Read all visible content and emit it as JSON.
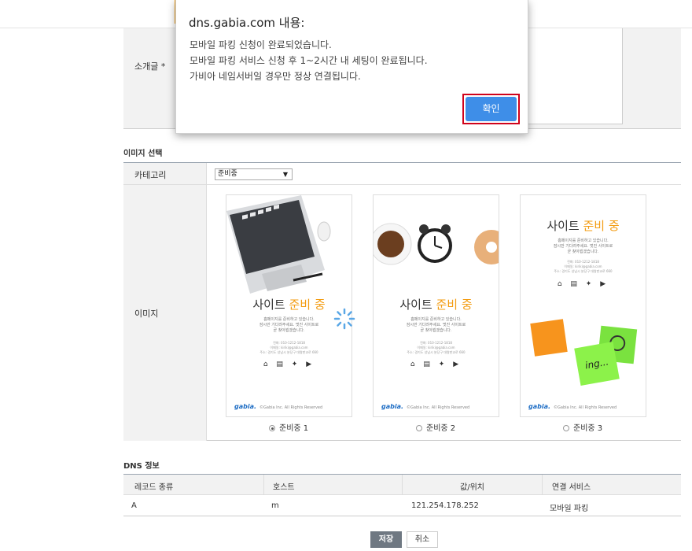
{
  "dialog": {
    "title": "dns.gabia.com 내용:",
    "lines": [
      "모바일 파킹 신청이 완료되었습니다.",
      "모바일 파킹 서비스 신청 후 1~2시간 내 세팅이 완료됩니다.",
      "가비아 네임서버일 경우만 정상 연결됩니다."
    ],
    "confirm_label": "확인"
  },
  "intro": {
    "label": "소개글 *"
  },
  "image_section": {
    "title": "이미지 선택",
    "category_label": "카테고리",
    "category_value": "준비중",
    "image_label": "이미지",
    "cards": [
      {
        "title_plain": "사이트 ",
        "title_highlight": "준비 중",
        "desc": "홈페이지를 준비하고 있습니다.\n잠시만 기다려주세요. 멋진 사이트로\n곧 찾아뵙겠습니다.",
        "info": "전화: 010-1212-1818\n이메일: kiriki@gabia.com\n주소: 경기도 성남시 분당구 대왕판교로 660",
        "footer_logo": "gabia.",
        "footer_text": "©Gabia Inc. All Rights Reserved",
        "radio_label": "준비중 1",
        "selected": true
      },
      {
        "title_plain": "사이트 ",
        "title_highlight": "준비 중",
        "desc": "홈페이지를 준비하고 있습니다.\n잠시만 기다려주세요. 멋진 사이트로\n곧 찾아뵙겠습니다.",
        "info": "전화: 010-1212-1818\n이메일: kiriki@gabia.com\n주소: 경기도 성남시 분당구 대왕판교로 660",
        "footer_logo": "gabia.",
        "footer_text": "©Gabia Inc. All Rights Reserved",
        "radio_label": "준비중 2",
        "selected": false
      },
      {
        "title_plain": "사이트 ",
        "title_highlight": "준비 중",
        "desc": "홈페이지를 준비하고 있습니다.\n잠시만 기다려주세요. 멋진 사이트로\n곧 찾아뵙겠습니다.",
        "info": "전화: 010-1212-1818\n이메일: kiriki@gabia.com\n주소: 경기도 성남시 분당구 대왕판교로 660",
        "footer_logo": "gabia.",
        "footer_text": "©Gabia Inc. All Rights Reserved",
        "radio_label": "준비중 3",
        "selected": false,
        "sticky_note": "ing..."
      }
    ]
  },
  "dns_section": {
    "title": "DNS 정보",
    "columns": [
      "레코드 종류",
      "호스트",
      "값/위치",
      "연결 서비스"
    ],
    "rows": [
      [
        "A",
        "m",
        "121.254.178.252",
        "모바일 파킹"
      ]
    ]
  },
  "buttons": {
    "save_label": "저장",
    "cancel_label": "취소"
  },
  "colors": {
    "accent": "#3e8ee8",
    "highlight": "#f39c12",
    "focus_ring": "#d0021b"
  }
}
